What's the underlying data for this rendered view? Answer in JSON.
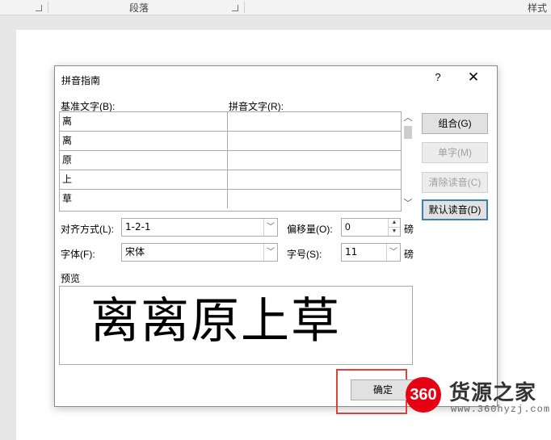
{
  "ribbon": {
    "paragraph_label": "段落",
    "styles_label": "样式"
  },
  "dialog": {
    "title": "拼音指南",
    "help": "?",
    "close": "✕",
    "base_text_header": "基准文字(B):",
    "ruby_text_header": "拼音文字(R):",
    "rows": [
      {
        "base": "离",
        "ruby": ""
      },
      {
        "base": "离",
        "ruby": ""
      },
      {
        "base": "原",
        "ruby": ""
      },
      {
        "base": "上",
        "ruby": ""
      },
      {
        "base": "草",
        "ruby": ""
      }
    ],
    "buttons": {
      "group": "组合(G)",
      "mono": "单字(M)",
      "clear": "清除读音(C)",
      "default": "默认读音(D)",
      "ok": "确定"
    },
    "alignment_label": "对齐方式(L):",
    "alignment_value": "1-2-1",
    "offset_label": "偏移量(O):",
    "offset_value": "0",
    "offset_unit": "磅",
    "font_label": "字体(F):",
    "font_value": "宋体",
    "size_label": "字号(S):",
    "size_value": "11",
    "size_unit": "磅",
    "preview_label": "预览",
    "preview_text": "离离原上草"
  },
  "watermark": {
    "logo": "360",
    "brand": "货源之家",
    "url": "www.360hyzj.com"
  }
}
